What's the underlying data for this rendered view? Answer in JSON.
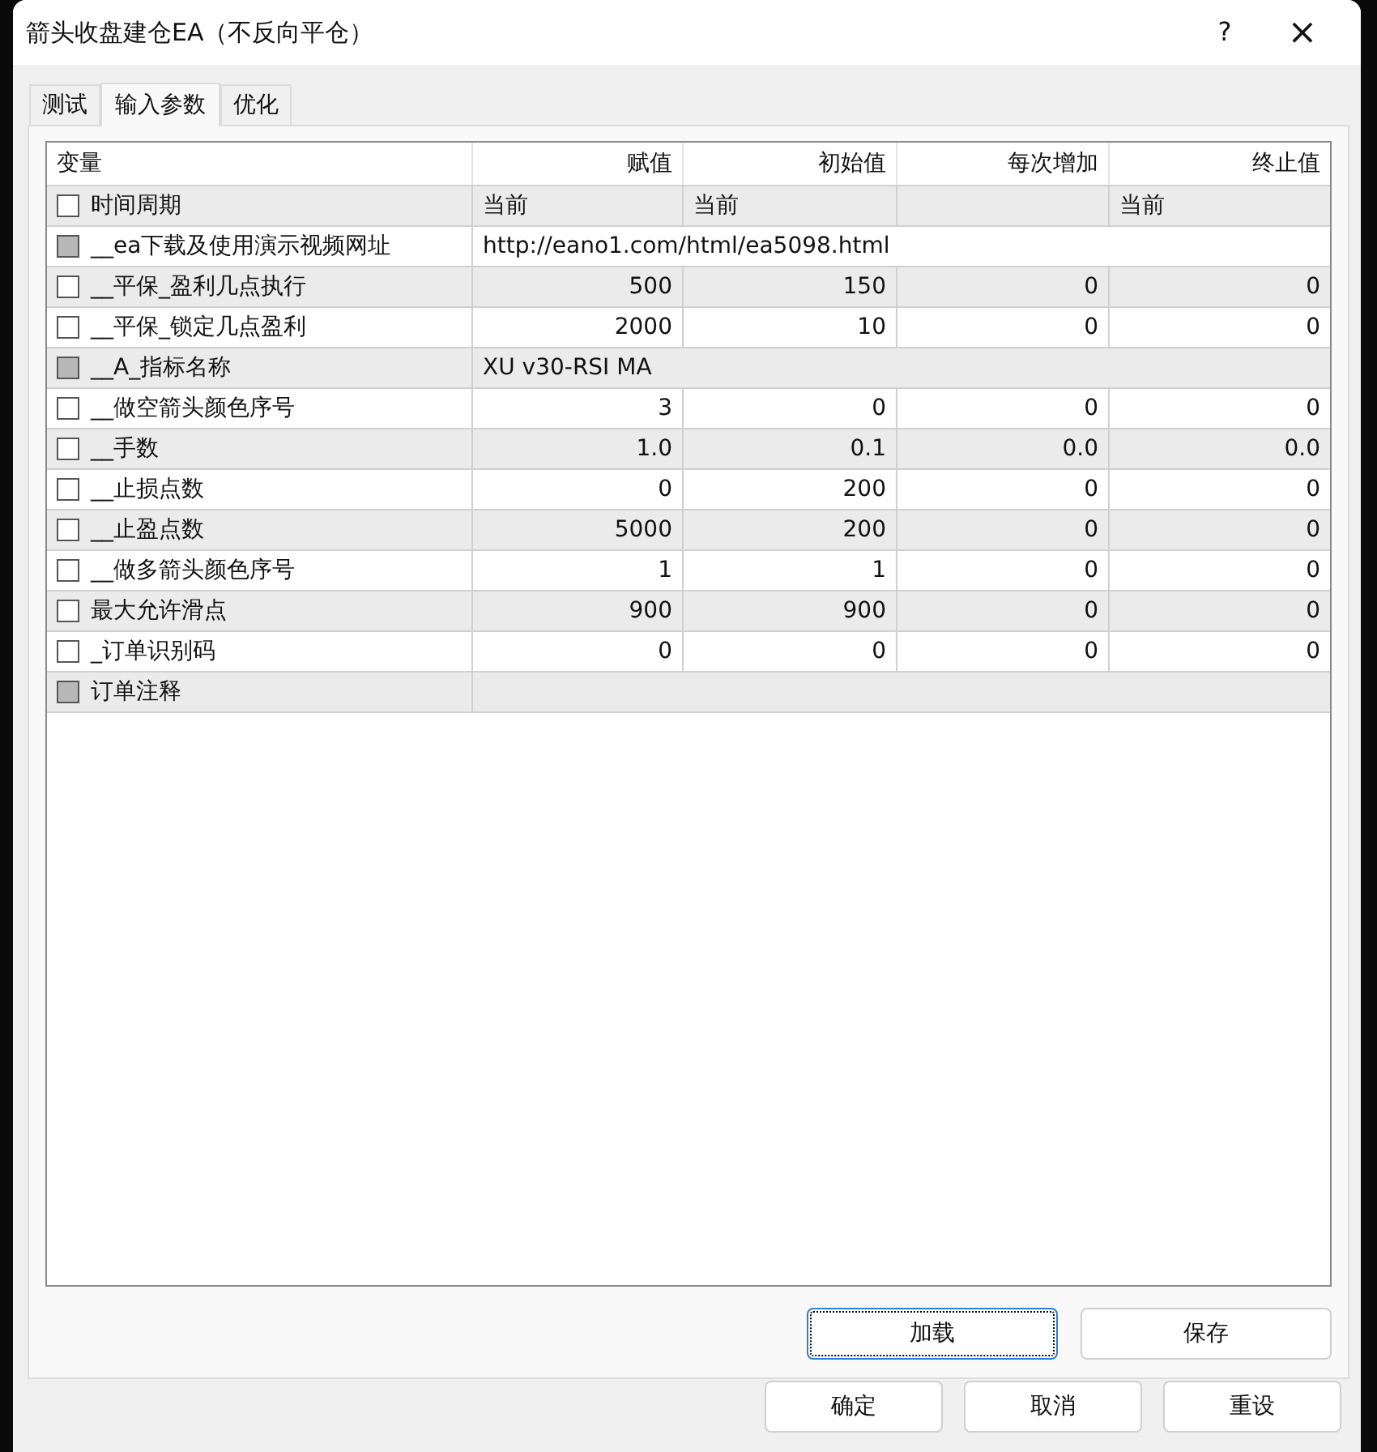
{
  "window": {
    "title": "箭头收盘建仓EA（不反向平仓）",
    "help": "?",
    "close": "×"
  },
  "tabs": [
    {
      "label": "测试",
      "selected": false
    },
    {
      "label": "输入参数",
      "selected": true
    },
    {
      "label": "优化",
      "selected": false
    }
  ],
  "table": {
    "columns": [
      "变量",
      "赋值",
      "初始值",
      "每次增加",
      "终止值"
    ],
    "rows": [
      {
        "kind": "enum",
        "name": "时间周期",
        "checked": false,
        "disabled": false,
        "value": "当前",
        "start": "当前",
        "stop": "当前"
      },
      {
        "kind": "text",
        "name": "__ea下载及使用演示视频网址",
        "checked": false,
        "disabled": true,
        "value": "http://eano1.com/html/ea5098.html"
      },
      {
        "kind": "number",
        "name": "__平保_盈利几点执行",
        "checked": false,
        "disabled": false,
        "value": "500",
        "start": "150",
        "step": "0",
        "stop": "0"
      },
      {
        "kind": "number",
        "name": "__平保_锁定几点盈利",
        "checked": false,
        "disabled": false,
        "value": "2000",
        "start": "10",
        "step": "0",
        "stop": "0"
      },
      {
        "kind": "text",
        "name": "__A_指标名称",
        "checked": false,
        "disabled": true,
        "value": "XU v30-RSI MA"
      },
      {
        "kind": "number",
        "name": "__做空箭头颜色序号",
        "checked": false,
        "disabled": false,
        "value": "3",
        "start": "0",
        "step": "0",
        "stop": "0"
      },
      {
        "kind": "number",
        "name": "__手数",
        "checked": false,
        "disabled": false,
        "value": "1.0",
        "start": "0.1",
        "step": "0.0",
        "stop": "0.0"
      },
      {
        "kind": "number",
        "name": "__止损点数",
        "checked": false,
        "disabled": false,
        "value": "0",
        "start": "200",
        "step": "0",
        "stop": "0"
      },
      {
        "kind": "number",
        "name": "__止盈点数",
        "checked": false,
        "disabled": false,
        "value": "5000",
        "start": "200",
        "step": "0",
        "stop": "0"
      },
      {
        "kind": "number",
        "name": "__做多箭头颜色序号",
        "checked": false,
        "disabled": false,
        "value": "1",
        "start": "1",
        "step": "0",
        "stop": "0"
      },
      {
        "kind": "number",
        "name": "最大允许滑点",
        "checked": false,
        "disabled": false,
        "value": "900",
        "start": "900",
        "step": "0",
        "stop": "0"
      },
      {
        "kind": "number",
        "name": "_订单识别码",
        "checked": false,
        "disabled": false,
        "value": "0",
        "start": "0",
        "step": "0",
        "stop": "0"
      },
      {
        "kind": "text",
        "name": "订单注释",
        "checked": false,
        "disabled": true
      }
    ]
  },
  "panel_buttons": [
    {
      "label": "加载",
      "focused": true
    },
    {
      "label": "保存",
      "focused": false
    }
  ],
  "dialog_buttons": [
    {
      "label": "确定",
      "focused": false
    },
    {
      "label": "取消",
      "focused": false
    },
    {
      "label": "重设",
      "focused": false
    }
  ]
}
